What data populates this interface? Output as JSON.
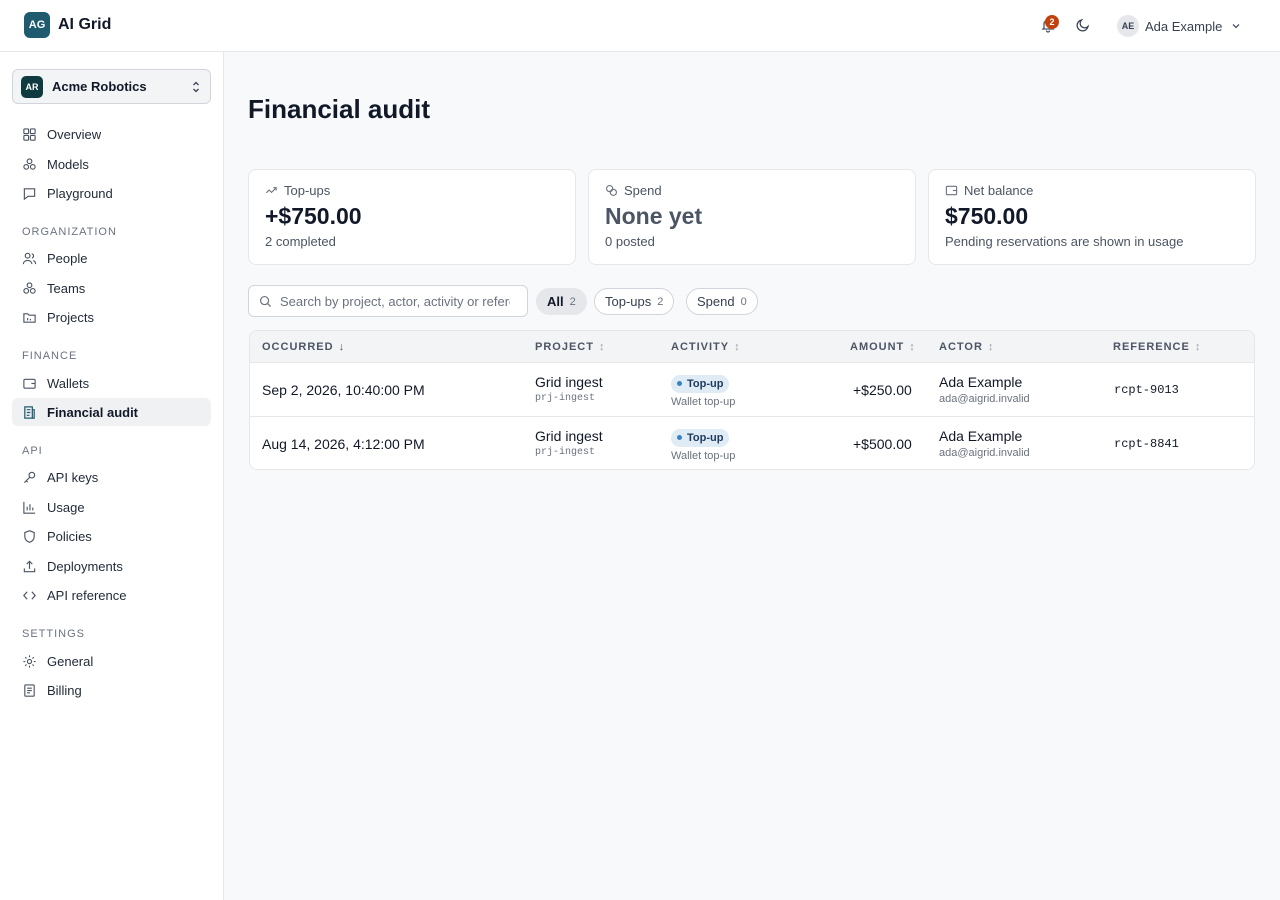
{
  "app": {
    "logo_text": "AG",
    "name": "AI Grid"
  },
  "topbar": {
    "notifications_count": "2",
    "user": {
      "initials": "AE",
      "name": "Ada Example"
    }
  },
  "sidebar": {
    "org": {
      "initials": "AR",
      "name": "Acme Robotics"
    },
    "items_main": [
      {
        "label": "Overview",
        "icon": "grid-icon"
      },
      {
        "label": "Models",
        "icon": "models-icon"
      },
      {
        "label": "Playground",
        "icon": "chat-icon"
      }
    ],
    "sections": {
      "organization": "ORGANIZATION",
      "finance": "FINANCE",
      "api": "API",
      "settings": "SETTINGS"
    },
    "items_org": [
      {
        "label": "People",
        "icon": "people-icon"
      },
      {
        "label": "Teams",
        "icon": "teams-icon"
      },
      {
        "label": "Projects",
        "icon": "folder-icon"
      }
    ],
    "items_finance": [
      {
        "label": "Wallets",
        "icon": "wallet-icon"
      },
      {
        "label": "Financial audit",
        "icon": "receipt-icon",
        "active": true
      }
    ],
    "items_api": [
      {
        "label": "API keys",
        "icon": "key-icon"
      },
      {
        "label": "Usage",
        "icon": "bar-chart-icon"
      },
      {
        "label": "Policies",
        "icon": "shield-icon"
      },
      {
        "label": "Deployments",
        "icon": "upload-icon"
      },
      {
        "label": "API reference",
        "icon": "code-icon"
      }
    ],
    "items_settings": [
      {
        "label": "General",
        "icon": "gear-icon"
      },
      {
        "label": "Billing",
        "icon": "document-icon"
      }
    ]
  },
  "page": {
    "title": "Financial audit"
  },
  "cards": [
    {
      "label": "Top-ups",
      "value": "+$750.00",
      "sub": "2 completed"
    },
    {
      "label": "Spend",
      "value": "None yet",
      "sub": "0 posted"
    },
    {
      "label": "Net balance",
      "value": "$750.00",
      "sub": "Pending reservations are shown in usage"
    }
  ],
  "search": {
    "placeholder": "Search by project, actor, activity or reference"
  },
  "filters": [
    {
      "label": "All",
      "count": "2"
    },
    {
      "label": "Top-ups",
      "count": "2"
    },
    {
      "label": "Spend",
      "count": "0"
    }
  ],
  "table": {
    "columns": [
      "OCCURRED",
      "PROJECT",
      "ACTIVITY",
      "AMOUNT",
      "ACTOR",
      "REFERENCE"
    ],
    "sort_icons": {
      "active": "↓",
      "inactive": "↕"
    },
    "rows": [
      {
        "occurred": "Sep 2, 2026, 10:40:00 PM",
        "project": "Grid ingest",
        "project_id": "prj-ingest",
        "activity": "Top-up",
        "activity_sub": "Wallet top-up",
        "amount": "+$250.00",
        "actor": "Ada Example",
        "actor_email": "ada@aigrid.invalid",
        "reference": "rcpt-9013"
      },
      {
        "occurred": "Aug 14, 2026, 4:12:00 PM",
        "project": "Grid ingest",
        "project_id": "prj-ingest",
        "activity": "Top-up",
        "activity_sub": "Wallet top-up",
        "amount": "+$500.00",
        "actor": "Ada Example",
        "actor_email": "ada@aigrid.invalid",
        "reference": "rcpt-8841"
      }
    ]
  },
  "colors": {
    "brand": "#1e5b6e",
    "badge": "#c2410c",
    "activity_dot": "#3b82c4"
  }
}
